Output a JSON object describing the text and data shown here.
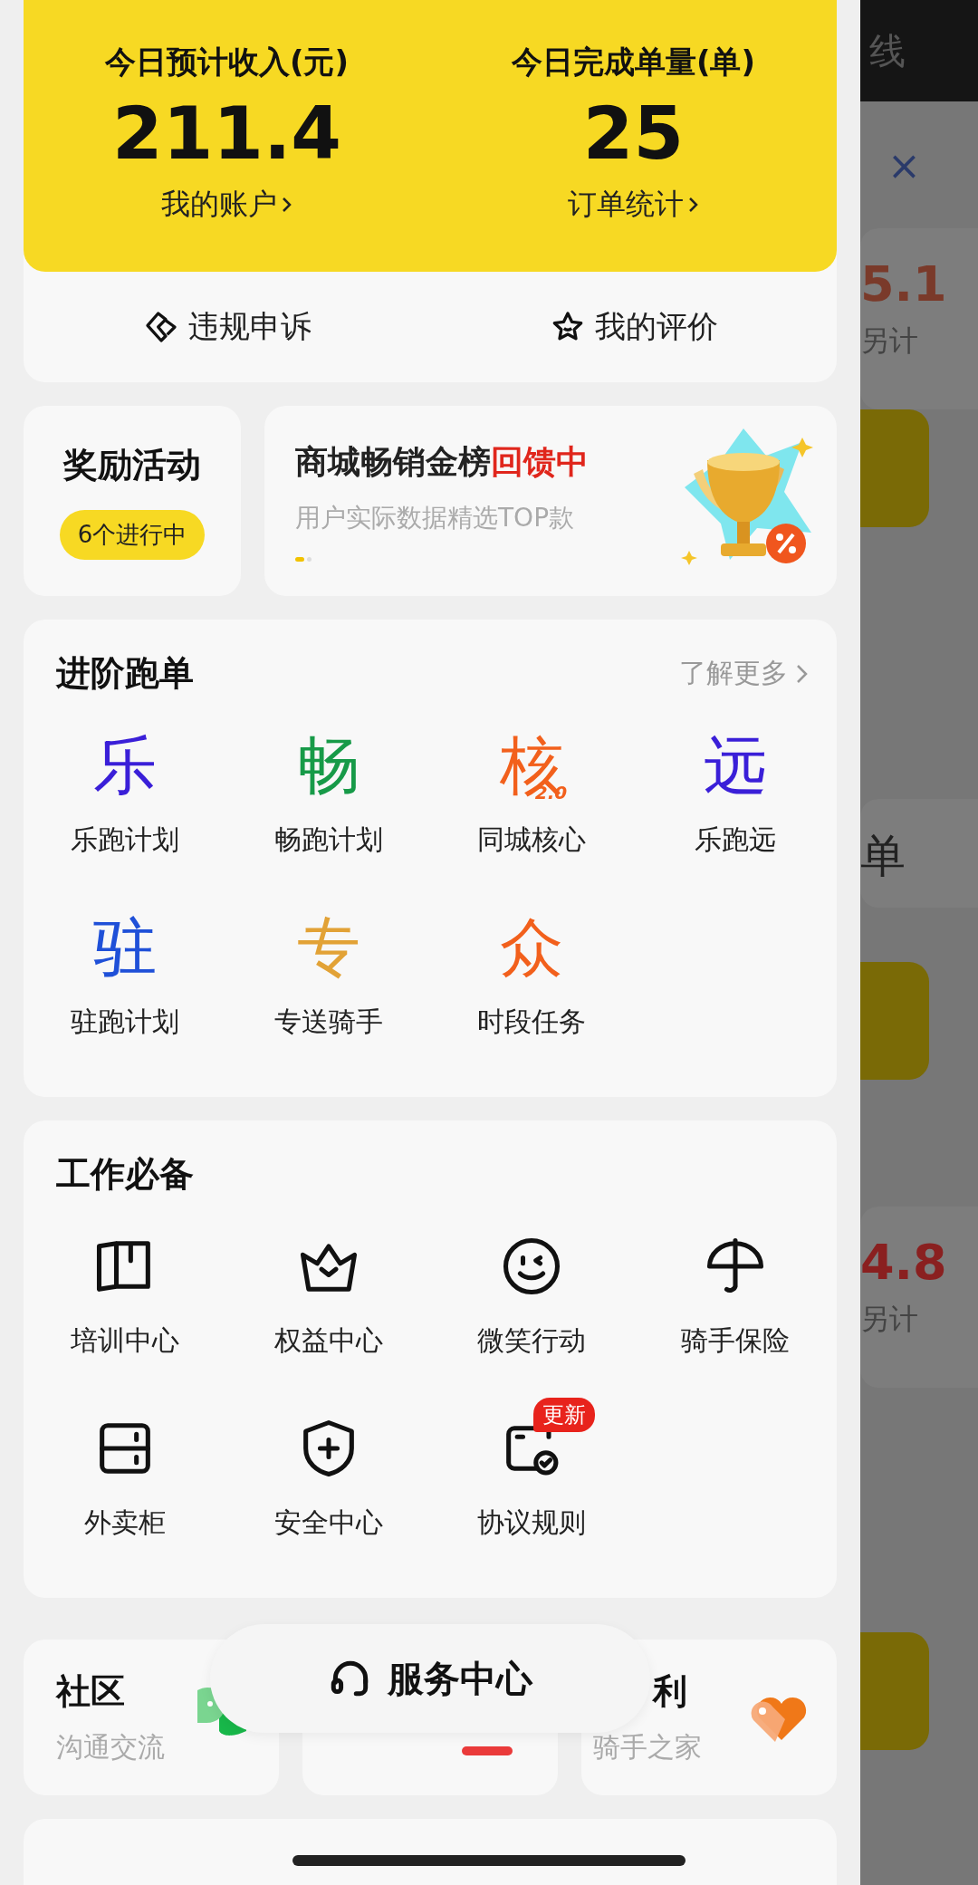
{
  "summary": {
    "stats": [
      {
        "label": "今日预计收入(元)",
        "value": "211.4",
        "link": "我的账户"
      },
      {
        "label": "今日完成单量(单)",
        "value": "25",
        "link": "订单统计"
      }
    ],
    "actions": [
      {
        "label": "违规申诉"
      },
      {
        "label": "我的评价"
      }
    ]
  },
  "rewards": {
    "title": "奖励活动",
    "badge": "6个进行中"
  },
  "banner": {
    "title": "商城畅销金榜",
    "highlight": "回馈中",
    "subtitle": "用户实际数据精选TOP款",
    "dots": [
      {
        "selected": true
      },
      {
        "selected": false
      }
    ]
  },
  "advanced": {
    "title": "进阶跑单",
    "more": "了解更多",
    "items": [
      {
        "glyph": "乐",
        "color": "#3a1fd8",
        "label": "乐跑计划"
      },
      {
        "glyph": "畅",
        "color": "#179a48",
        "label": "畅跑计划"
      },
      {
        "glyph": "核",
        "note": "2.0",
        "color": "#f2601c",
        "label": "同城核心"
      },
      {
        "glyph": "远",
        "color": "#3a1fd8",
        "label": "乐跑远"
      },
      {
        "glyph": "驻",
        "color": "#1f50d8",
        "label": "驻跑计划"
      },
      {
        "glyph": "专",
        "color": "#e2a236",
        "label": "专送骑手"
      },
      {
        "glyph": "众",
        "color": "#f2601c",
        "label": "时段任务"
      }
    ]
  },
  "essentials": {
    "title": "工作必备",
    "items": [
      {
        "label": "培训中心"
      },
      {
        "label": "权益中心"
      },
      {
        "label": "微笑行动"
      },
      {
        "label": "骑手保险"
      },
      {
        "label": "外卖柜"
      },
      {
        "label": "安全中心"
      },
      {
        "label": "协议规则",
        "badge": "更新"
      }
    ]
  },
  "bottom_cards": [
    {
      "title": "社区",
      "subtitle": "沟通交流"
    },
    {
      "kind": "covered"
    },
    {
      "title": "利",
      "subtitle": "骑手之家"
    }
  ],
  "service_button": {
    "label": "服务中心"
  },
  "background_page": {
    "top": "线",
    "close": "×",
    "cards": [
      {
        "amount": "5.1",
        "note": "另计"
      },
      {
        "heading": "单"
      },
      {
        "amount": "4.8",
        "note": "另计"
      }
    ]
  }
}
